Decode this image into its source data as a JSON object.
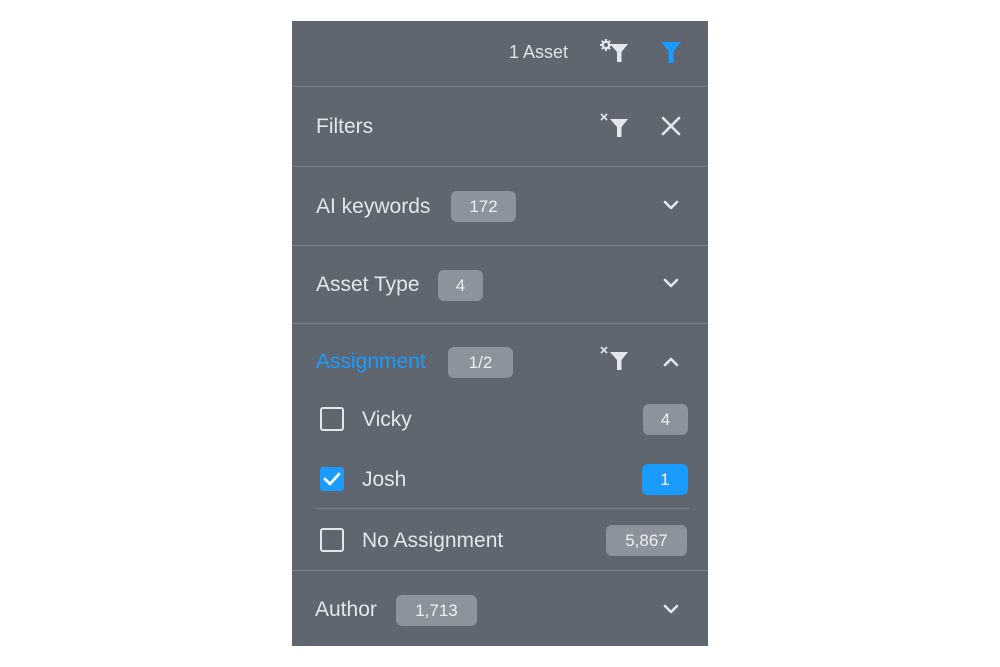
{
  "header": {
    "asset_count": "1 Asset"
  },
  "filters_header": {
    "title": "Filters"
  },
  "sections": [
    {
      "title": "AI keywords",
      "count": "172",
      "expanded": false
    },
    {
      "title": "Asset Type",
      "count": "4",
      "expanded": false
    },
    {
      "title": "Assignment",
      "count": "1/2",
      "expanded": true
    },
    {
      "title": "Author",
      "count": "1,713",
      "expanded": false
    }
  ],
  "assignment_options": [
    {
      "label": "Vicky",
      "count": "4",
      "checked": false
    },
    {
      "label": "Josh",
      "count": "1",
      "checked": true
    },
    {
      "label": "No Assignment",
      "count": "5,867",
      "checked": false
    }
  ],
  "colors": {
    "panel_bg": "#5f6670",
    "accent": "#1a9bff",
    "badge_bg": "#8c939c",
    "text": "#e3e6ea"
  },
  "icons": {
    "filter_settings": "filter-settings-icon",
    "filter_active": "filter-icon",
    "clear_filter": "clear-filter-icon",
    "close": "close-icon",
    "chevron_down": "chevron-down-icon",
    "chevron_up": "chevron-up-icon",
    "check": "check-icon"
  }
}
